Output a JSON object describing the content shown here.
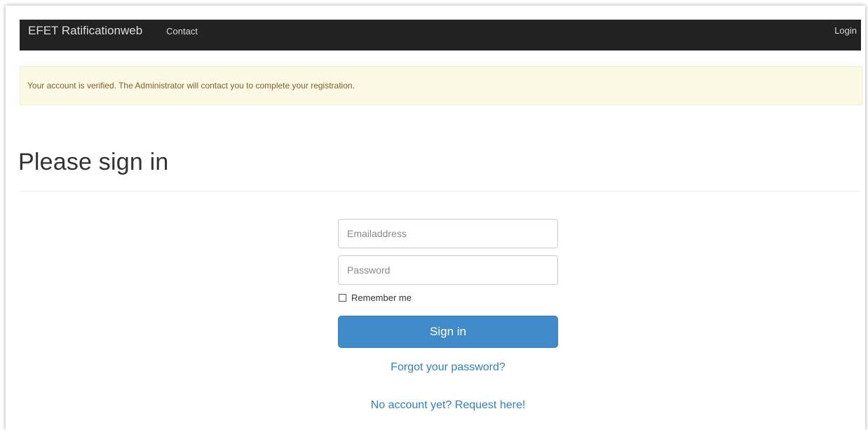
{
  "navbar": {
    "brand": "EFET Ratificationweb",
    "contact": "Contact",
    "login": "Login"
  },
  "alert": {
    "message": "Your account is verified. The Administrator will contact you to complete your registration."
  },
  "main": {
    "title": "Please sign in",
    "email_placeholder": "Emailaddress",
    "password_placeholder": "Password",
    "remember_label": "Remember me",
    "signin_label": "Sign in",
    "forgot_link": "Forgot your password?",
    "request_link": "No account yet? Request here!"
  },
  "colors": {
    "navbar_bg": "#222222",
    "alert_bg": "#fcf8e3",
    "primary": "#428bca",
    "link": "#2f80c8"
  }
}
